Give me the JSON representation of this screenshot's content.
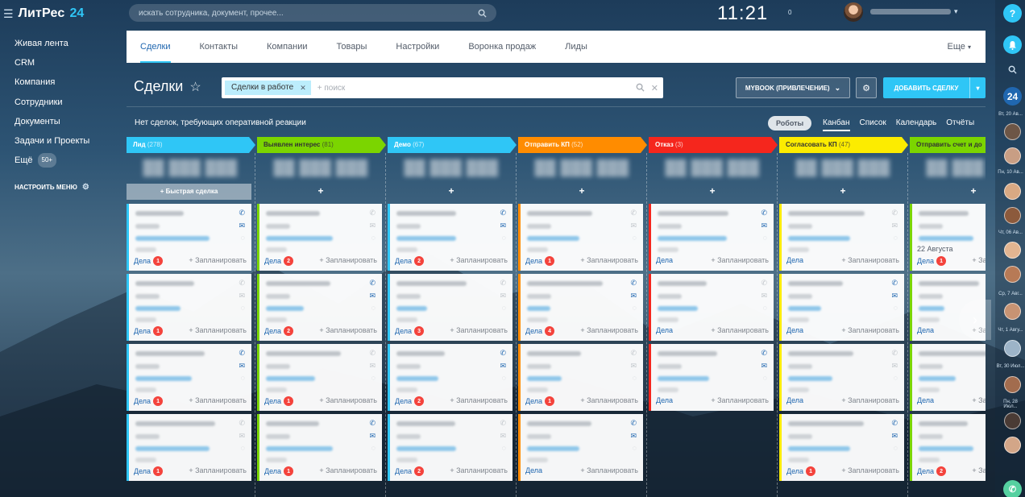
{
  "sidebar": {
    "logo_text": "ЛитРес",
    "logo_num": "24",
    "items": [
      {
        "label": "Живая лента"
      },
      {
        "label": "CRM"
      },
      {
        "label": "Компания"
      },
      {
        "label": "Сотрудники"
      },
      {
        "label": "Документы"
      },
      {
        "label": "Задачи и Проекты"
      },
      {
        "label": "Ещё",
        "badge": "50+"
      }
    ],
    "setup_label": "НАСТРОИТЬ МЕНЮ"
  },
  "topbar": {
    "search_placeholder": "искать сотрудника, документ, прочее...",
    "clock": "11:21",
    "clock_flag": "0"
  },
  "tabs": [
    {
      "label": "Сделки",
      "active": true
    },
    {
      "label": "Контакты"
    },
    {
      "label": "Компании"
    },
    {
      "label": "Товары"
    },
    {
      "label": "Настройки"
    },
    {
      "label": "Воронка продаж"
    },
    {
      "label": "Лиды"
    }
  ],
  "tabs_more": "Еще",
  "page": {
    "title": "Сделки",
    "filter_chip": "Сделки в работе",
    "filter_placeholder": "+ поиск",
    "pipeline_button": "MYBOOK (ПРИВЛЕЧЕНИЕ)",
    "add_button": "ДОБАВИТЬ СДЕЛКУ",
    "info_text": "Нет сделок, требующих оперативной реакции",
    "robots": "Роботы",
    "views": [
      {
        "label": "Канбан",
        "active": true
      },
      {
        "label": "Список"
      },
      {
        "label": "Календарь"
      },
      {
        "label": "Отчёты"
      }
    ]
  },
  "card_labels": {
    "dela": "Дела",
    "plan": "+ Запланировать",
    "quick_add": "Быстрая сделка"
  },
  "colors": {
    "accent": "#2fc6f6",
    "link": "#2067b0",
    "counter": "#f4433c"
  },
  "stages": [
    {
      "name": "Лид",
      "count": "(278)",
      "color": "#2fc6f6",
      "text": "#ffffff",
      "cards": [
        {
          "dela": "1"
        },
        {
          "dela": "1"
        },
        {
          "dela": "1"
        },
        {
          "dela": "1"
        }
      ]
    },
    {
      "name": "Выявлен интерес",
      "count": "(81)",
      "color": "#7bd500",
      "text": "#333333",
      "cards": [
        {
          "dela": "2"
        },
        {
          "dela": "2"
        },
        {
          "dela": "1"
        },
        {
          "dela": "1"
        }
      ]
    },
    {
      "name": "Демо",
      "count": "(67)",
      "color": "#2fc6f6",
      "text": "#ffffff",
      "cards": [
        {
          "dela": "2"
        },
        {
          "dela": "3"
        },
        {
          "dela": "2"
        },
        {
          "dela": "2"
        }
      ]
    },
    {
      "name": "Отправить КП",
      "count": "(52)",
      "color": "#ff8c00",
      "text": "#ffffff",
      "cards": [
        {
          "dela": "1"
        },
        {
          "dela": "4"
        },
        {
          "dela": "1"
        },
        {
          "dela": ""
        }
      ]
    },
    {
      "name": "Отказ",
      "count": "(3)",
      "color": "#f5261d",
      "text": "#ffffff",
      "cards": [
        {
          "dela": ""
        },
        {
          "dela": ""
        },
        {
          "dela": ""
        }
      ]
    },
    {
      "name": "Согласовать КП",
      "count": "(47)",
      "color": "#fcec00",
      "text": "#333333",
      "cards": [
        {
          "dela": ""
        },
        {
          "dela": ""
        },
        {
          "dela": ""
        },
        {
          "dela": "1"
        }
      ]
    },
    {
      "name": "Отправить счет и до",
      "count": "",
      "color": "#7bd500",
      "text": "#333333",
      "cards": [
        {
          "dela": "1",
          "date": "22 Августа"
        },
        {
          "dela": ""
        },
        {
          "dela": ""
        },
        {
          "dela": "2"
        }
      ]
    }
  ],
  "right_strip": {
    "help": "?",
    "counter": "24",
    "dates": [
      "Вт, 20 Ав...",
      "Пн, 10 Ав...",
      "Чт, 06 Ав...",
      "Ср, 7 Авг...",
      "Чт, 1 Авгу...",
      "Вт, 30 Июл...",
      "Пн, 28 Июл..."
    ]
  }
}
